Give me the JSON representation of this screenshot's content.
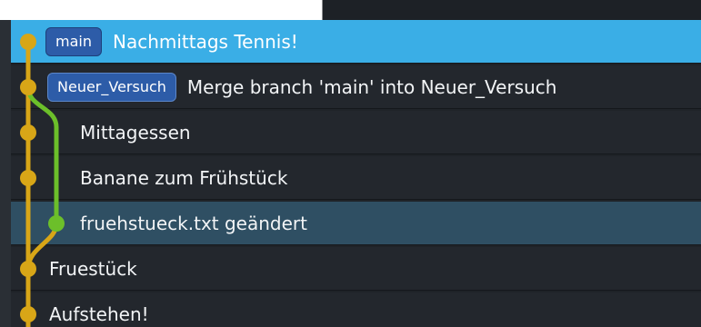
{
  "commits": [
    {
      "branch": "main",
      "message": "Nachmittags Tennis!",
      "state": "selected"
    },
    {
      "branch": "Neuer_Versuch",
      "message": "Merge branch 'main' into Neuer_Versuch",
      "state": "plain"
    },
    {
      "branch": "",
      "message": "Mittagessen",
      "state": "plain"
    },
    {
      "branch": "",
      "message": "Banane zum Frühstück",
      "state": "plain"
    },
    {
      "branch": "",
      "message": "fruehstueck.txt geändert",
      "state": "highlight"
    },
    {
      "branch": "",
      "message": "Fruestück",
      "state": "plain"
    },
    {
      "branch": "",
      "message": "Aufstehen!",
      "state": "plain"
    }
  ],
  "colors": {
    "main_lane": "#d8a617",
    "side_lane": "#6cbf2a",
    "selected_row": "#3aaee6",
    "highlight_row": "#2f4f63",
    "badge": "#2d5ca8"
  }
}
